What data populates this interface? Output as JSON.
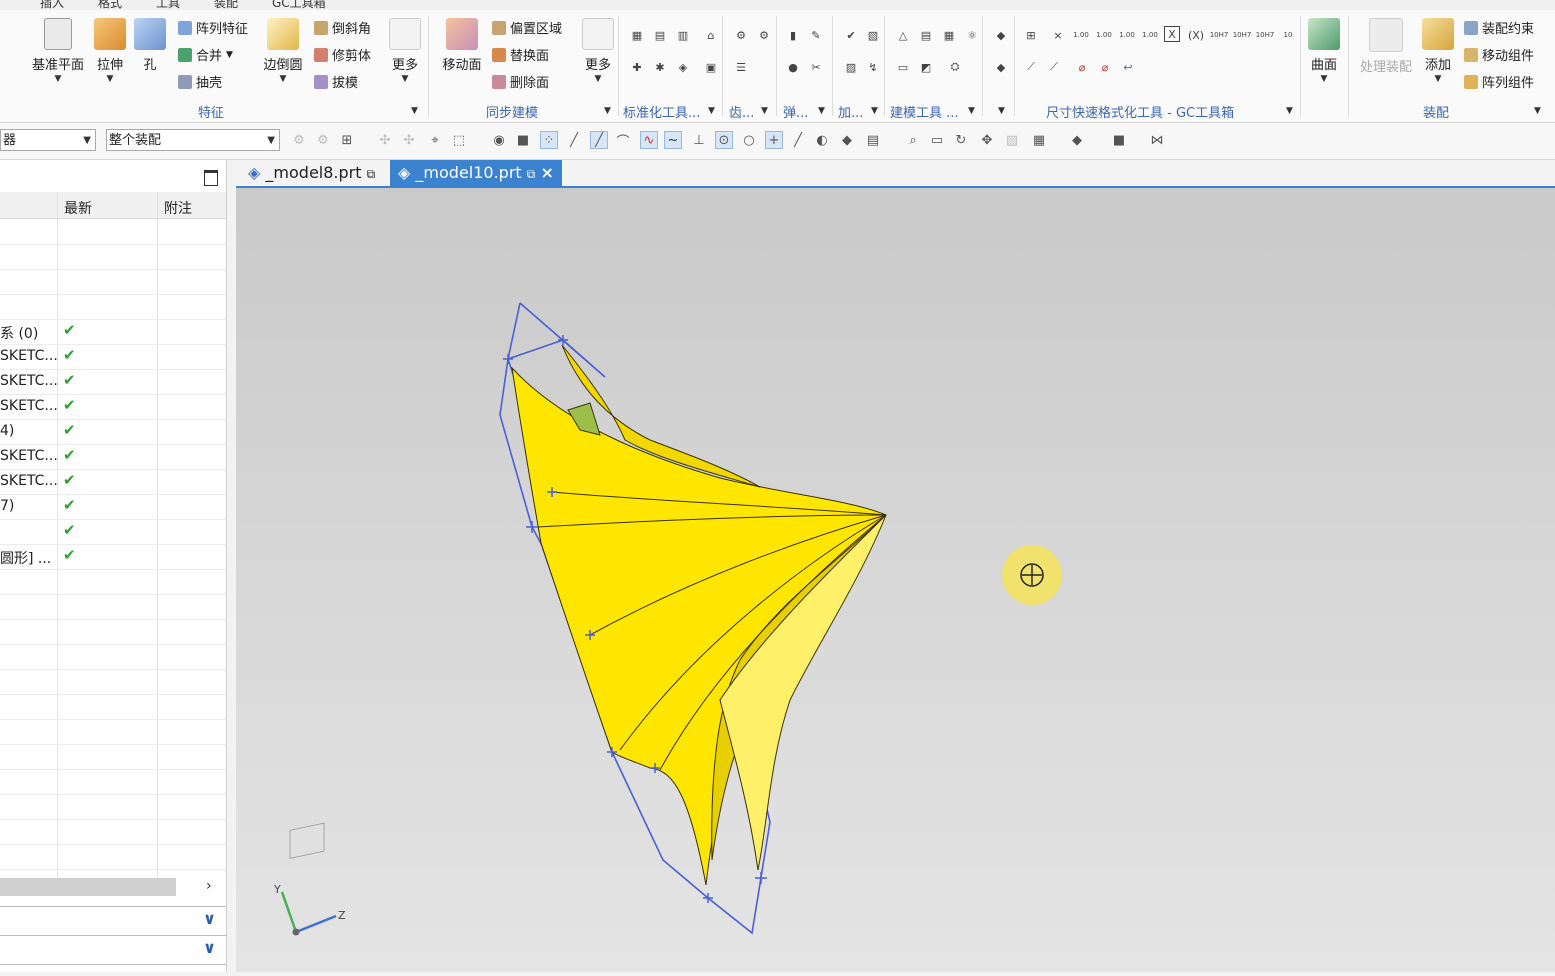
{
  "menubar": {
    "items": [
      "插入",
      "格式",
      "工具",
      "装配",
      "GC工具箱"
    ]
  },
  "ribbon": {
    "feature_group": {
      "title": "特征",
      "datum_plane": "基准平面",
      "extrude": "拉伸",
      "hole": "孔",
      "pattern_feature": "阵列特征",
      "unite": "合并",
      "shell": "抽壳",
      "edge_blend": "边倒圆",
      "chamfer": "倒斜角",
      "trim_body": "修剪体",
      "draft": "拔模",
      "more": "更多"
    },
    "sync_group": {
      "title": "同步建模",
      "move_face": "移动面",
      "offset_region": "偏置区域",
      "replace_face": "替换面",
      "delete_face": "删除面",
      "more": "更多"
    },
    "standard_group": {
      "title": "标准化工具..."
    },
    "gear_group": {
      "title": "齿..."
    },
    "spring_group": {
      "title": "弹..."
    },
    "process_group": {
      "title": "加..."
    },
    "modeling_tools_group": {
      "title": "建模工具 ..."
    },
    "dim_group": {
      "title": "尺寸快速格式化工具 - GC工具箱"
    },
    "surface_group": {
      "surface": "曲面"
    },
    "assembly_group": {
      "title": "装配",
      "process_assembly": "处理装配",
      "add": "添加",
      "assembly_constraints": "装配约束",
      "move_component": "移动组件",
      "pattern_component": "阵列组件"
    },
    "dim_labels": [
      "1.00",
      "1.00",
      "1.00",
      "1.00",
      "10H7",
      "10H7",
      "10H7",
      "10"
    ]
  },
  "toolbar": {
    "filter_combo": "器",
    "scope_combo": "整个装配"
  },
  "nav": {
    "col_latest": "最新",
    "col_note": "附注",
    "rows": [
      {
        "name": "",
        "check": ""
      },
      {
        "name": "",
        "check": ""
      },
      {
        "name": "",
        "check": ""
      },
      {
        "name": "",
        "check": ""
      },
      {
        "name": "系 (0)",
        "check": "✔"
      },
      {
        "name": "SKETC...",
        "check": "✔"
      },
      {
        "name": "SKETC...",
        "check": "✔"
      },
      {
        "name": "SKETC...",
        "check": "✔"
      },
      {
        "name": "4)",
        "check": "✔"
      },
      {
        "name": "SKETC...",
        "check": "✔"
      },
      {
        "name": "SKETC...",
        "check": "✔"
      },
      {
        "name": "7)",
        "check": "✔"
      },
      {
        "name": "",
        "check": "✔"
      },
      {
        "name": "圆形] ...",
        "check": "✔"
      }
    ]
  },
  "tabs": [
    {
      "label": "_model8.prt",
      "active": false
    },
    {
      "label": "_model10.prt",
      "active": true
    }
  ],
  "viewport": {
    "triad_labels": {
      "x": "",
      "y": "Y",
      "z": "Z"
    },
    "model_color": "#ffe600",
    "wire_color": "#4a5fd6",
    "accent_color": "#3b82d0"
  }
}
